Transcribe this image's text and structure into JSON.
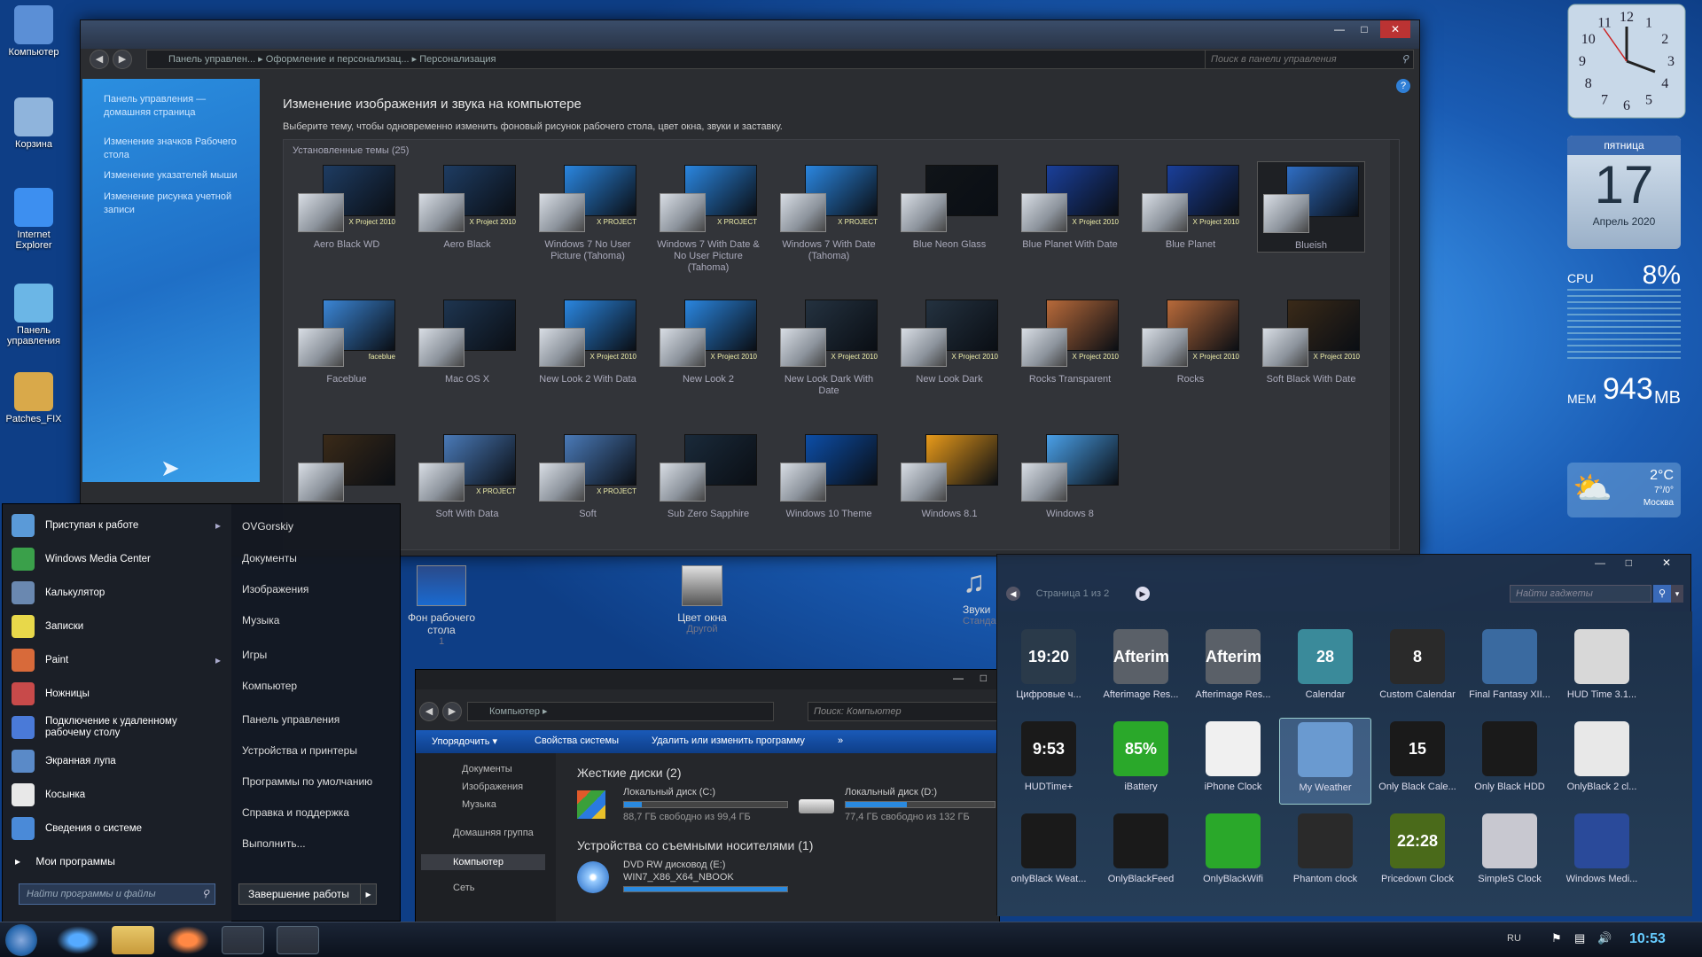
{
  "desktop": {
    "icons": [
      {
        "label": "Компьютер",
        "color": "#5b8fd6"
      },
      {
        "label": "Корзина",
        "color": "#8fb4dc"
      },
      {
        "label": "Internet Explorer",
        "color": "#3d8ff0"
      },
      {
        "label": "Панель управления",
        "color": "#6bb6e6"
      },
      {
        "label": "Patches_FIX",
        "color": "#d9a94a"
      }
    ]
  },
  "main_window": {
    "breadcrumb": [
      "Панель управлен...",
      "Оформление и персонализац...",
      "Персонализация"
    ],
    "search_placeholder": "Поиск в панели управления",
    "help": "?",
    "left_links": [
      "Панель управления — домашняя страница",
      "Изменение значков Рабочего стола",
      "Изменение указателей мыши",
      "Изменение рисунка учетной записи"
    ],
    "heading": "Изменение изображения и звука на компьютере",
    "subheading": "Выберите тему, чтобы одновременно изменить фоновый рисунок рабочего стола, цвет окна, звуки и заставку.",
    "section": "Установленные темы (25)",
    "themes": [
      {
        "name": "Aero Black WD",
        "color": "#1e3c62",
        "badge": "X Project 2010"
      },
      {
        "name": "Aero Black",
        "color": "#1e3c62",
        "badge": "X Project 2010"
      },
      {
        "name": "Windows 7 No User Picture (Tahoma)",
        "color": "#2a86e0",
        "badge": "X PROJECT"
      },
      {
        "name": "Windows 7 With Date & No User Picture (Tahoma)",
        "color": "#2a86e0",
        "badge": "X PROJECT"
      },
      {
        "name": "Windows 7 With Date (Tahoma)",
        "color": "#2a86e0",
        "badge": "X PROJECT"
      },
      {
        "name": "Blue Neon Glass",
        "color": "#101418",
        "badge": ""
      },
      {
        "name": "Blue Planet With Date",
        "color": "#1a3f9a",
        "badge": "X Project 2010"
      },
      {
        "name": "Blue Planet",
        "color": "#1a3f9a",
        "badge": "X Project 2010"
      },
      {
        "name": "Blueish",
        "color": "#2f6ec4",
        "badge": ""
      },
      {
        "name": "Faceblue",
        "color": "#3b86d6",
        "badge": "faceblue"
      },
      {
        "name": "Mac OS X",
        "color": "#1e3550",
        "badge": ""
      },
      {
        "name": "New Look 2 With Data",
        "color": "#2a86e0",
        "badge": "X Project 2010"
      },
      {
        "name": "New Look 2",
        "color": "#2a86e0",
        "badge": "X Project 2010"
      },
      {
        "name": "New Look Dark With Date",
        "color": "#243240",
        "badge": "X Project 2010"
      },
      {
        "name": "New Look Dark",
        "color": "#243240",
        "badge": "X Project 2010"
      },
      {
        "name": "Rocks Transparent",
        "color": "#b86a3a",
        "badge": "X Project 2010"
      },
      {
        "name": "Rocks",
        "color": "#b86a3a",
        "badge": "X Project 2010"
      },
      {
        "name": "Soft Black With Date",
        "color": "#3a2a18",
        "badge": "X Project 2010"
      },
      {
        "name": "",
        "color": "#3a2a18",
        "badge": ""
      },
      {
        "name": "Soft With Data",
        "color": "#4a7ab8",
        "badge": "X PROJECT"
      },
      {
        "name": "Soft",
        "color": "#4a7ab8",
        "badge": "X PROJECT"
      },
      {
        "name": "Sub Zero Sapphire",
        "color": "#1a2a3a",
        "badge": ""
      },
      {
        "name": "Windows 10 Theme",
        "color": "#0c4ea8",
        "badge": ""
      },
      {
        "name": "Windows 8.1",
        "color": "#e89a1a",
        "badge": ""
      },
      {
        "name": "Windows 8",
        "color": "#4aa0e8",
        "badge": ""
      }
    ],
    "bottom": [
      {
        "label": "Фон рабочего стола",
        "sub": "1"
      },
      {
        "label": "Цвет окна",
        "sub": "Другой"
      },
      {
        "label": "Звуки",
        "sub": "Стандартный"
      }
    ]
  },
  "start_menu": {
    "items": [
      {
        "label": "Приступая к работе",
        "color": "#5a9ad8",
        "arrow": "▸"
      },
      {
        "label": "Windows Media Center",
        "color": "#3aa04a",
        "arrow": ""
      },
      {
        "label": "Калькулятор",
        "color": "#6a88b0",
        "arrow": ""
      },
      {
        "label": "Записки",
        "color": "#e8d84a",
        "arrow": ""
      },
      {
        "label": "Paint",
        "color": "#d86a3a",
        "arrow": "▸"
      },
      {
        "label": "Ножницы",
        "color": "#c84a4a",
        "arrow": ""
      },
      {
        "label": "Подключение к удаленному рабочему столу",
        "color": "#4a7ad8",
        "arrow": ""
      },
      {
        "label": "Экранная лупа",
        "color": "#5a8ac8",
        "arrow": ""
      },
      {
        "label": "Косынка",
        "color": "#e8e8e8",
        "arrow": ""
      },
      {
        "label": "Сведения о системе",
        "color": "#4a8ad8",
        "arrow": ""
      }
    ],
    "all_programs": "Мои программы",
    "search_placeholder": "Найти программы и файлы",
    "right": [
      "OVGorskiy",
      "Документы",
      "Изображения",
      "Музыка",
      "Игры",
      "Компьютер",
      "Панель управления",
      "Устройства и принтеры",
      "Программы по умолчанию",
      "Справка и поддержка",
      "Выполнить..."
    ],
    "shutdown": "Завершение работы"
  },
  "explorer": {
    "breadcrumb": "Компьютер",
    "search_placeholder": "Поиск: Компьютер",
    "toolbar": [
      "Упорядочить ▾",
      "Свойства системы",
      "Удалить или изменить программу",
      "»"
    ],
    "nav": [
      "Документы",
      "Изображения",
      "Музыка",
      "Домашняя группа",
      "Компьютер",
      "Сеть"
    ],
    "hdd_header": "Жесткие диски (2)",
    "drives": [
      {
        "name": "Локальный диск (C:)",
        "free": "88,7 ГБ свободно из 99,4 ГБ",
        "fill": 0.11
      },
      {
        "name": "Локальный диск (D:)",
        "free": "77,4 ГБ свободно из 132 ГБ",
        "fill": 0.41
      }
    ],
    "removable_header": "Устройства со съемными носителями (1)",
    "dvd": {
      "name": "DVD RW дисковод (E:)",
      "label": "WIN7_X86_X64_NBOOK"
    }
  },
  "gadgets": {
    "page": "Страница 1 из 2",
    "search_placeholder": "Найти гаджеты",
    "items": [
      {
        "label": "Цифровые ч...",
        "text": "19:20",
        "color": "#2a3a4a"
      },
      {
        "label": "Afterimage Res...",
        "text": "Afterimage",
        "color": "#5a6068"
      },
      {
        "label": "Afterimage Res...",
        "text": "Afterimage",
        "color": "#5a6068"
      },
      {
        "label": "Calendar",
        "text": "28",
        "color": "#3a8a9a"
      },
      {
        "label": "Custom Calendar",
        "text": "8",
        "color": "#2a2a2a"
      },
      {
        "label": "Final Fantasy XII...",
        "text": "",
        "color": "#3a6aa0"
      },
      {
        "label": "HUD Time 3.1...",
        "text": "",
        "color": "#d8d8d8"
      },
      {
        "label": "HUDTime+",
        "text": "9:53 AM",
        "color": "#1a1a1a"
      },
      {
        "label": "iBattery",
        "text": "85%",
        "color": "#2aa82a"
      },
      {
        "label": "iPhone Clock",
        "text": "",
        "color": "#f0f0f0"
      },
      {
        "label": "My Weather",
        "text": "",
        "color": "#6a9ad0"
      },
      {
        "label": "Only Black Cale...",
        "text": "15",
        "color": "#1a1a1a"
      },
      {
        "label": "Only Black HDD",
        "text": "",
        "color": "#1a1a1a"
      },
      {
        "label": "OnlyBlack 2 cl...",
        "text": "",
        "color": "#e8e8e8"
      },
      {
        "label": "onlyBlack Weat...",
        "text": "",
        "color": "#1a1a1a"
      },
      {
        "label": "OnlyBlackFeed",
        "text": "",
        "color": "#1a1a1a"
      },
      {
        "label": "OnlyBlackWifi",
        "text": "",
        "color": "#2aa82a"
      },
      {
        "label": "Phantom clock",
        "text": "",
        "color": "#2a2a2a"
      },
      {
        "label": "Pricedown Clock",
        "text": "22:28",
        "color": "#4a6a1a"
      },
      {
        "label": "SimpleS Clock",
        "text": "",
        "color": "#c8c8d0"
      },
      {
        "label": "Windows Medi...",
        "text": "",
        "color": "#2a4a9a"
      }
    ]
  },
  "side_gadgets": {
    "clock_numbers": [
      "12",
      "1",
      "2",
      "3",
      "4",
      "5",
      "6",
      "7",
      "8",
      "9",
      "10",
      "11"
    ],
    "calendar": {
      "weekday": "пятница",
      "day": "17",
      "month": "Апрель 2020"
    },
    "cpu": {
      "label": "CPU",
      "value": "8%"
    },
    "mem": {
      "label": "MEM",
      "value": "943",
      "unit": "MB"
    },
    "weather": {
      "temp": "2°C",
      "range": "7°/0°",
      "city": "Москва"
    }
  },
  "taskbar": {
    "lang": "RU",
    "time": "10:53"
  }
}
